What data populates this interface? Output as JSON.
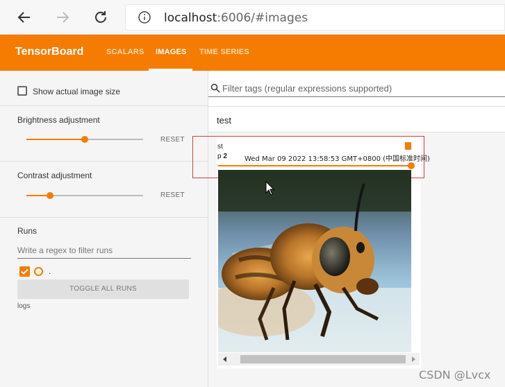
{
  "browser": {
    "url_host": "localhost",
    "url_rest": ":6006/#images"
  },
  "header": {
    "logo": "TensorBoard",
    "tabs": [
      {
        "label": "SCALARS",
        "active": false
      },
      {
        "label": "IMAGES",
        "active": true
      },
      {
        "label": "TIME SERIES",
        "active": false
      }
    ],
    "accent_color": "#f57c00"
  },
  "sidebar": {
    "show_actual_size_label": "Show actual image size",
    "show_actual_size_checked": false,
    "brightness": {
      "label": "Brightness adjustment",
      "reset": "RESET",
      "value": 0.5
    },
    "contrast": {
      "label": "Contrast adjustment",
      "reset": "RESET",
      "value": 0.2
    },
    "runs": {
      "title": "Runs",
      "filter_placeholder": "Write a regex to filter runs",
      "run_name": ".",
      "toggle_all": "TOGGLE ALL RUNS",
      "logdir": "logs"
    }
  },
  "main": {
    "filter_placeholder": "Filter tags (regular expressions supported)",
    "group_title": "test",
    "card": {
      "tag": "st",
      "step_prefix": "p",
      "step_value": "2",
      "timestamp": "Wed Mar 09 2022 13:58:53 GMT+0800 (中国标准时间)",
      "step_slider_value": 1.0
    }
  },
  "watermark": "CSDN @Lvcx"
}
